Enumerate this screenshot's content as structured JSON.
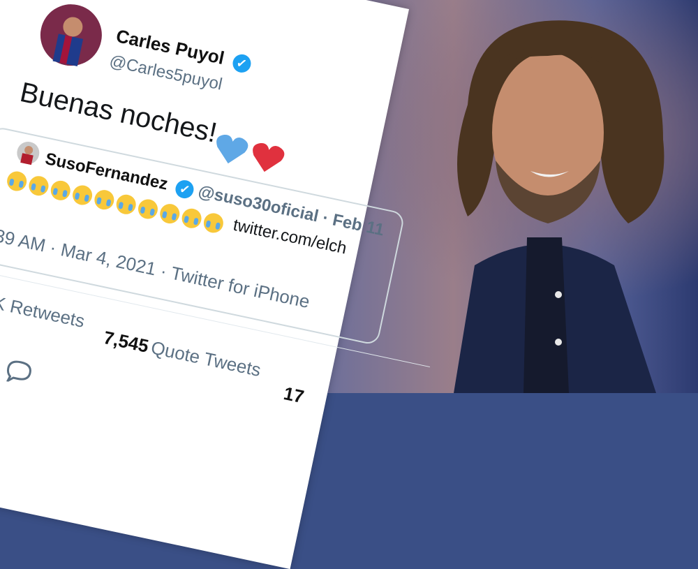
{
  "tweet": {
    "author_name": "Carles Puyol",
    "author_handle": "@Carles5puyol",
    "text": "Buenas noches!",
    "timestamp": "39 AM · Mar 4, 2021 · Twitter for iPhone",
    "retweets_label": "K Retweets",
    "quote_count": "7,545",
    "quote_label": "Quote Tweets",
    "likes_partial": "17"
  },
  "quoted": {
    "author_name": "SusoFernandez",
    "author_handle": "@suso30oficial",
    "date": "· Feb 11",
    "link": "twitter.com/elch"
  },
  "icons": {
    "verified": "verified-badge-icon",
    "reply": "reply-icon",
    "blue_heart": "blue-heart-icon",
    "red_heart": "red-heart-icon",
    "crying_face": "crying-face-icon"
  },
  "colors": {
    "twitter_blue": "#1da1f2",
    "text_gray": "#5b7083",
    "heart_red": "#e0313e",
    "heart_blue": "#5fa8e6"
  }
}
